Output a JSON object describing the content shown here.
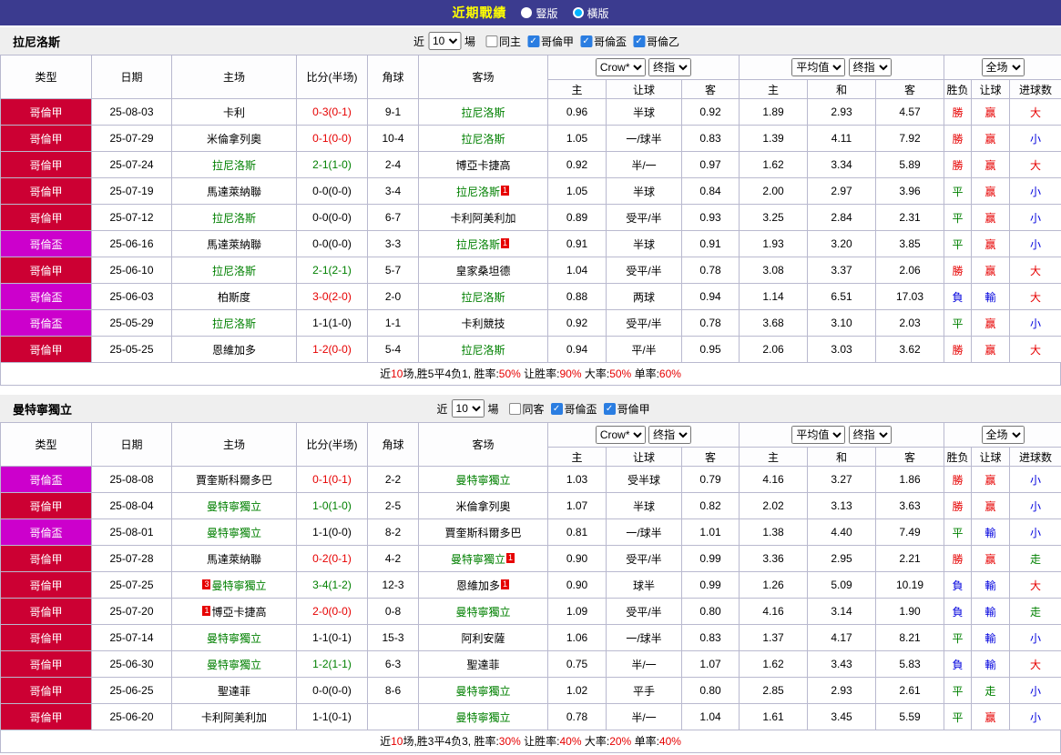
{
  "topbar": {
    "title": "近期戰績",
    "radios": [
      {
        "label": "豎版",
        "selected": false
      },
      {
        "label": "橫版",
        "selected": true
      }
    ]
  },
  "labels": {
    "near": "近",
    "games": "場"
  },
  "colors": {
    "red": "#e60000",
    "green": "#008000",
    "blue": "#0000dd",
    "black": "#000000"
  },
  "league_colors": {
    "哥倫甲": "#cc0033",
    "哥倫盃": "#cc00cc"
  },
  "table_header": {
    "cols": [
      "类型",
      "日期",
      "主场",
      "比分(半场)",
      "角球",
      "客场"
    ],
    "g1": [
      "Crow*",
      "终指"
    ],
    "g1sub": [
      "主",
      "让球",
      "客"
    ],
    "g2": [
      "平均值",
      "终指"
    ],
    "g2sub": [
      "主",
      "和",
      "客"
    ],
    "g3": [
      "全场"
    ],
    "g3sub": [
      "胜负",
      "让球",
      "进球数"
    ]
  },
  "sections": [
    {
      "team": "拉尼洛斯",
      "filter": {
        "games": "10",
        "checkboxes": [
          {
            "label": "同主",
            "checked": false
          },
          {
            "label": "哥倫甲",
            "checked": true
          },
          {
            "label": "哥倫盃",
            "checked": true
          },
          {
            "label": "哥倫乙",
            "checked": true
          }
        ]
      },
      "rows": [
        {
          "lg": "哥倫甲",
          "date": "25-08-03",
          "home": {
            "n": "卡利"
          },
          "score": {
            "t": "0-3(0-1)",
            "c": "red"
          },
          "cn": "9-1",
          "away": {
            "n": "拉尼洛斯",
            "f": 1
          },
          "o1": [
            "0.96",
            "半球",
            "0.92"
          ],
          "o2": [
            "1.89",
            "2.93",
            "4.57"
          ],
          "res": [
            [
              "勝",
              "red"
            ],
            [
              "赢",
              "red"
            ],
            [
              "大",
              "red"
            ]
          ]
        },
        {
          "lg": "哥倫甲",
          "date": "25-07-29",
          "home": {
            "n": "米倫拿列奧"
          },
          "score": {
            "t": "0-1(0-0)",
            "c": "red"
          },
          "cn": "10-4",
          "away": {
            "n": "拉尼洛斯",
            "f": 1
          },
          "o1": [
            "1.05",
            "一/球半",
            "0.83"
          ],
          "o2": [
            "1.39",
            "4.11",
            "7.92"
          ],
          "res": [
            [
              "勝",
              "red"
            ],
            [
              "赢",
              "red"
            ],
            [
              "小",
              "blue"
            ]
          ]
        },
        {
          "lg": "哥倫甲",
          "date": "25-07-24",
          "home": {
            "n": "拉尼洛斯",
            "f": 1
          },
          "score": {
            "t": "2-1(1-0)",
            "c": "green"
          },
          "cn": "2-4",
          "away": {
            "n": "博亞卡捷高"
          },
          "o1": [
            "0.92",
            "半/一",
            "0.97"
          ],
          "o2": [
            "1.62",
            "3.34",
            "5.89"
          ],
          "res": [
            [
              "勝",
              "red"
            ],
            [
              "赢",
              "red"
            ],
            [
              "大",
              "red"
            ]
          ]
        },
        {
          "lg": "哥倫甲",
          "date": "25-07-19",
          "home": {
            "n": "馬達萊納聯"
          },
          "score": {
            "t": "0-0(0-0)",
            "c": "black"
          },
          "cn": "3-4",
          "away": {
            "n": "拉尼洛斯",
            "f": 1,
            "rc": "1"
          },
          "o1": [
            "1.05",
            "半球",
            "0.84"
          ],
          "o2": [
            "2.00",
            "2.97",
            "3.96"
          ],
          "res": [
            [
              "平",
              "green"
            ],
            [
              "赢",
              "red"
            ],
            [
              "小",
              "blue"
            ]
          ]
        },
        {
          "lg": "哥倫甲",
          "date": "25-07-12",
          "home": {
            "n": "拉尼洛斯",
            "f": 1
          },
          "score": {
            "t": "0-0(0-0)",
            "c": "black"
          },
          "cn": "6-7",
          "away": {
            "n": "卡利阿美利加"
          },
          "o1": [
            "0.89",
            "受平/半",
            "0.93"
          ],
          "o2": [
            "3.25",
            "2.84",
            "2.31"
          ],
          "res": [
            [
              "平",
              "green"
            ],
            [
              "赢",
              "red"
            ],
            [
              "小",
              "blue"
            ]
          ]
        },
        {
          "lg": "哥倫盃",
          "date": "25-06-16",
          "home": {
            "n": "馬達萊納聯"
          },
          "score": {
            "t": "0-0(0-0)",
            "c": "black"
          },
          "cn": "3-3",
          "away": {
            "n": "拉尼洛斯",
            "f": 1,
            "rc": "1"
          },
          "o1": [
            "0.91",
            "半球",
            "0.91"
          ],
          "o2": [
            "1.93",
            "3.20",
            "3.85"
          ],
          "res": [
            [
              "平",
              "green"
            ],
            [
              "赢",
              "red"
            ],
            [
              "小",
              "blue"
            ]
          ]
        },
        {
          "lg": "哥倫甲",
          "date": "25-06-10",
          "home": {
            "n": "拉尼洛斯",
            "f": 1
          },
          "score": {
            "t": "2-1(2-1)",
            "c": "green"
          },
          "cn": "5-7",
          "away": {
            "n": "皇家桑坦德"
          },
          "o1": [
            "1.04",
            "受平/半",
            "0.78"
          ],
          "o2": [
            "3.08",
            "3.37",
            "2.06"
          ],
          "res": [
            [
              "勝",
              "red"
            ],
            [
              "赢",
              "red"
            ],
            [
              "大",
              "red"
            ]
          ]
        },
        {
          "lg": "哥倫盃",
          "date": "25-06-03",
          "home": {
            "n": "柏斯度"
          },
          "score": {
            "t": "3-0(2-0)",
            "c": "red"
          },
          "cn": "2-0",
          "away": {
            "n": "拉尼洛斯",
            "f": 1
          },
          "o1": [
            "0.88",
            "两球",
            "0.94"
          ],
          "o2": [
            "1.14",
            "6.51",
            "17.03"
          ],
          "res": [
            [
              "負",
              "blue"
            ],
            [
              "輸",
              "blue"
            ],
            [
              "大",
              "red"
            ]
          ]
        },
        {
          "lg": "哥倫盃",
          "date": "25-05-29",
          "home": {
            "n": "拉尼洛斯",
            "f": 1
          },
          "score": {
            "t": "1-1(1-0)",
            "c": "black"
          },
          "cn": "1-1",
          "away": {
            "n": "卡利競技"
          },
          "o1": [
            "0.92",
            "受平/半",
            "0.78"
          ],
          "o2": [
            "3.68",
            "3.10",
            "2.03"
          ],
          "res": [
            [
              "平",
              "green"
            ],
            [
              "赢",
              "red"
            ],
            [
              "小",
              "blue"
            ]
          ]
        },
        {
          "lg": "哥倫甲",
          "date": "25-05-25",
          "home": {
            "n": "恩維加多"
          },
          "score": {
            "t": "1-2(0-0)",
            "c": "red"
          },
          "cn": "5-4",
          "away": {
            "n": "拉尼洛斯",
            "f": 1
          },
          "o1": [
            "0.94",
            "平/半",
            "0.95"
          ],
          "o2": [
            "2.06",
            "3.03",
            "3.62"
          ],
          "res": [
            [
              "勝",
              "red"
            ],
            [
              "赢",
              "red"
            ],
            [
              "大",
              "red"
            ]
          ]
        }
      ],
      "summary": [
        [
          "近",
          "black"
        ],
        [
          "10",
          "red"
        ],
        [
          "场,胜5平4负1, 胜率:",
          "black"
        ],
        [
          "50%",
          "red"
        ],
        [
          " 让胜率:",
          "black"
        ],
        [
          "90%",
          "red"
        ],
        [
          " 大率:",
          "black"
        ],
        [
          "50%",
          "red"
        ],
        [
          " 单率:",
          "black"
        ],
        [
          "60%",
          "red"
        ]
      ]
    },
    {
      "team": "曼特寧獨立",
      "filter": {
        "games": "10",
        "checkboxes": [
          {
            "label": "同客",
            "checked": false
          },
          {
            "label": "哥倫盃",
            "checked": true
          },
          {
            "label": "哥倫甲",
            "checked": true
          }
        ]
      },
      "rows": [
        {
          "lg": "哥倫盃",
          "date": "25-08-08",
          "home": {
            "n": "賈奎斯科爾多巴"
          },
          "score": {
            "t": "0-1(0-1)",
            "c": "red"
          },
          "cn": "2-2",
          "away": {
            "n": "曼特寧獨立",
            "f": 1
          },
          "o1": [
            "1.03",
            "受半球",
            "0.79"
          ],
          "o2": [
            "4.16",
            "3.27",
            "1.86"
          ],
          "res": [
            [
              "勝",
              "red"
            ],
            [
              "赢",
              "red"
            ],
            [
              "小",
              "blue"
            ]
          ]
        },
        {
          "lg": "哥倫甲",
          "date": "25-08-04",
          "home": {
            "n": "曼特寧獨立",
            "f": 1
          },
          "score": {
            "t": "1-0(1-0)",
            "c": "green"
          },
          "cn": "2-5",
          "away": {
            "n": "米倫拿列奧"
          },
          "o1": [
            "1.07",
            "半球",
            "0.82"
          ],
          "o2": [
            "2.02",
            "3.13",
            "3.63"
          ],
          "res": [
            [
              "勝",
              "red"
            ],
            [
              "赢",
              "red"
            ],
            [
              "小",
              "blue"
            ]
          ]
        },
        {
          "lg": "哥倫盃",
          "date": "25-08-01",
          "home": {
            "n": "曼特寧獨立",
            "f": 1
          },
          "score": {
            "t": "1-1(0-0)",
            "c": "black"
          },
          "cn": "8-2",
          "away": {
            "n": "賈奎斯科爾多巴"
          },
          "o1": [
            "0.81",
            "一/球半",
            "1.01"
          ],
          "o2": [
            "1.38",
            "4.40",
            "7.49"
          ],
          "res": [
            [
              "平",
              "green"
            ],
            [
              "輸",
              "blue"
            ],
            [
              "小",
              "blue"
            ]
          ]
        },
        {
          "lg": "哥倫甲",
          "date": "25-07-28",
          "home": {
            "n": "馬達萊納聯"
          },
          "score": {
            "t": "0-2(0-1)",
            "c": "red"
          },
          "cn": "4-2",
          "away": {
            "n": "曼特寧獨立",
            "f": 1,
            "rc": "1"
          },
          "o1": [
            "0.90",
            "受平/半",
            "0.99"
          ],
          "o2": [
            "3.36",
            "2.95",
            "2.21"
          ],
          "res": [
            [
              "勝",
              "red"
            ],
            [
              "赢",
              "red"
            ],
            [
              "走",
              "green"
            ]
          ]
        },
        {
          "lg": "哥倫甲",
          "date": "25-07-25",
          "home": {
            "n": "曼特寧獨立",
            "f": 1,
            "rc": "3"
          },
          "score": {
            "t": "3-4(1-2)",
            "c": "green"
          },
          "cn": "12-3",
          "away": {
            "n": "恩維加多",
            "rc": "1"
          },
          "o1": [
            "0.90",
            "球半",
            "0.99"
          ],
          "o2": [
            "1.26",
            "5.09",
            "10.19"
          ],
          "res": [
            [
              "負",
              "blue"
            ],
            [
              "輸",
              "blue"
            ],
            [
              "大",
              "red"
            ]
          ]
        },
        {
          "lg": "哥倫甲",
          "date": "25-07-20",
          "home": {
            "n": "博亞卡捷高",
            "rc": "1"
          },
          "score": {
            "t": "2-0(0-0)",
            "c": "red"
          },
          "cn": "0-8",
          "away": {
            "n": "曼特寧獨立",
            "f": 1
          },
          "o1": [
            "1.09",
            "受平/半",
            "0.80"
          ],
          "o2": [
            "4.16",
            "3.14",
            "1.90"
          ],
          "res": [
            [
              "負",
              "blue"
            ],
            [
              "輸",
              "blue"
            ],
            [
              "走",
              "green"
            ]
          ]
        },
        {
          "lg": "哥倫甲",
          "date": "25-07-14",
          "home": {
            "n": "曼特寧獨立",
            "f": 1
          },
          "score": {
            "t": "1-1(0-1)",
            "c": "black"
          },
          "cn": "15-3",
          "away": {
            "n": "阿利安薩"
          },
          "o1": [
            "1.06",
            "一/球半",
            "0.83"
          ],
          "o2": [
            "1.37",
            "4.17",
            "8.21"
          ],
          "res": [
            [
              "平",
              "green"
            ],
            [
              "輸",
              "blue"
            ],
            [
              "小",
              "blue"
            ]
          ]
        },
        {
          "lg": "哥倫甲",
          "date": "25-06-30",
          "home": {
            "n": "曼特寧獨立",
            "f": 1
          },
          "score": {
            "t": "1-2(1-1)",
            "c": "green"
          },
          "cn": "6-3",
          "away": {
            "n": "聖達菲"
          },
          "o1": [
            "0.75",
            "半/一",
            "1.07"
          ],
          "o2": [
            "1.62",
            "3.43",
            "5.83"
          ],
          "res": [
            [
              "負",
              "blue"
            ],
            [
              "輸",
              "blue"
            ],
            [
              "大",
              "red"
            ]
          ]
        },
        {
          "lg": "哥倫甲",
          "date": "25-06-25",
          "home": {
            "n": "聖達菲"
          },
          "score": {
            "t": "0-0(0-0)",
            "c": "black"
          },
          "cn": "8-6",
          "away": {
            "n": "曼特寧獨立",
            "f": 1
          },
          "o1": [
            "1.02",
            "平手",
            "0.80"
          ],
          "o2": [
            "2.85",
            "2.93",
            "2.61"
          ],
          "res": [
            [
              "平",
              "green"
            ],
            [
              "走",
              "green"
            ],
            [
              "小",
              "blue"
            ]
          ]
        },
        {
          "lg": "哥倫甲",
          "date": "25-06-20",
          "home": {
            "n": "卡利阿美利加"
          },
          "score": {
            "t": "1-1(0-1)",
            "c": "black"
          },
          "cn": "",
          "away": {
            "n": "曼特寧獨立",
            "f": 1
          },
          "o1": [
            "0.78",
            "半/一",
            "1.04"
          ],
          "o2": [
            "1.61",
            "3.45",
            "5.59"
          ],
          "res": [
            [
              "平",
              "green"
            ],
            [
              "赢",
              "red"
            ],
            [
              "小",
              "blue"
            ]
          ]
        }
      ],
      "summary": [
        [
          "近",
          "black"
        ],
        [
          "10",
          "red"
        ],
        [
          "场,胜3平4负3, 胜率:",
          "black"
        ],
        [
          "30%",
          "red"
        ],
        [
          " 让胜率:",
          "black"
        ],
        [
          "40%",
          "red"
        ],
        [
          " 大率:",
          "black"
        ],
        [
          "20%",
          "red"
        ],
        [
          " 单率:",
          "black"
        ],
        [
          "40%",
          "red"
        ]
      ]
    }
  ]
}
